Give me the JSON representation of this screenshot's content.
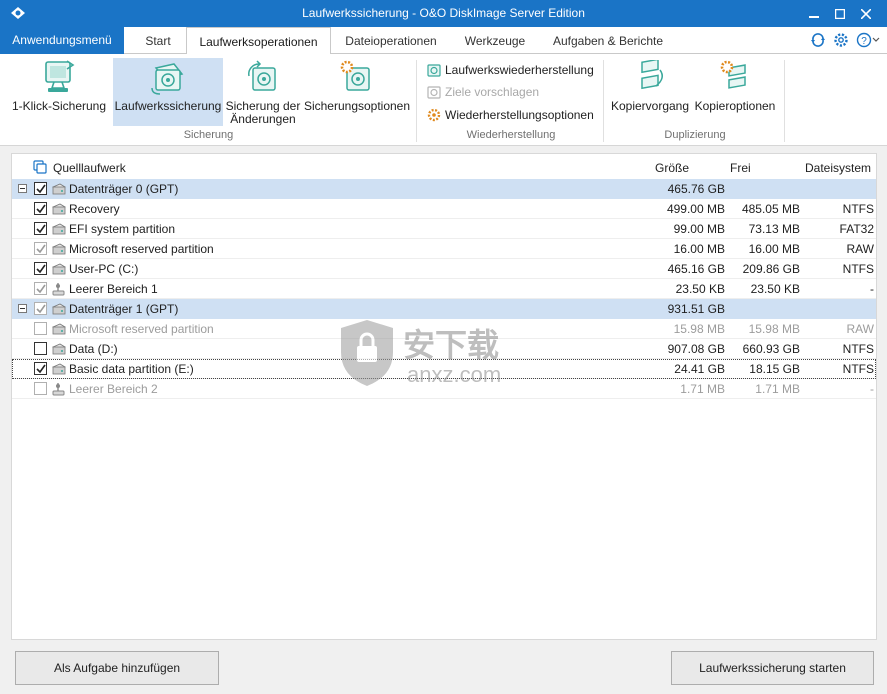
{
  "window": {
    "title": "Laufwerkssicherung - O&O DiskImage Server Edition"
  },
  "menu": {
    "app_menu": "Anwendungsmenü",
    "tabs": [
      "Start",
      "Laufwerksoperationen",
      "Dateioperationen",
      "Werkzeuge",
      "Aufgaben & Berichte"
    ],
    "active_tab": "Laufwerksoperationen"
  },
  "ribbon": {
    "one_click": "1-Klick-Sicherung",
    "drive_backup": "Laufwerkssicherung",
    "changes_line1": "Sicherung der",
    "changes_line2": "Änderungen",
    "backup_options": "Sicherungsoptionen",
    "group_backup": "Sicherung",
    "restore": "Laufwerkswiederherstellung",
    "suggest": "Ziele vorschlagen",
    "restore_options": "Wiederherstellungsoptionen",
    "group_restore": "Wiederherstellung",
    "copy": "Kopiervorgang",
    "copy_options": "Kopieroptionen",
    "group_dup": "Duplizierung"
  },
  "table": {
    "headers": {
      "source": "Quelllaufwerk",
      "size": "Größe",
      "free": "Frei",
      "fs": "Dateisystem"
    },
    "rows": [
      {
        "name": "Datenträger 0 (GPT)",
        "size": "465.76 GB",
        "free": "",
        "fs": ""
      },
      {
        "name": "Recovery",
        "size": "499.00 MB",
        "free": "485.05 MB",
        "fs": "NTFS"
      },
      {
        "name": "EFI system partition",
        "size": "99.00 MB",
        "free": "73.13 MB",
        "fs": "FAT32"
      },
      {
        "name": "Microsoft reserved partition",
        "size": "16.00 MB",
        "free": "16.00 MB",
        "fs": "RAW"
      },
      {
        "name": "User-PC (C:)",
        "size": "465.16 GB",
        "free": "209.86 GB",
        "fs": "NTFS"
      },
      {
        "name": "Leerer Bereich 1",
        "size": "23.50 KB",
        "free": "23.50 KB",
        "fs": "-"
      },
      {
        "name": "Datenträger 1 (GPT)",
        "size": "931.51 GB",
        "free": "",
        "fs": ""
      },
      {
        "name": "Microsoft reserved partition",
        "size": "15.98 MB",
        "free": "15.98 MB",
        "fs": "RAW"
      },
      {
        "name": "Data (D:)",
        "size": "907.08 GB",
        "free": "660.93 GB",
        "fs": "NTFS"
      },
      {
        "name": "Basic data partition (E:)",
        "size": "24.41 GB",
        "free": "18.15 GB",
        "fs": "NTFS"
      },
      {
        "name": "Leerer Bereich 2",
        "size": "1.71 MB",
        "free": "1.71 MB",
        "fs": "-"
      }
    ]
  },
  "footer": {
    "add_task": "Als Aufgabe hinzufügen",
    "start": "Laufwerkssicherung starten"
  },
  "watermark": {
    "text1": "安下载",
    "text2": "anxz.com"
  },
  "colors": {
    "accent": "#1a74c6",
    "selection": "#cfe0f3",
    "icon_green": "#3aa89b",
    "icon_orange": "#e08a1e"
  }
}
